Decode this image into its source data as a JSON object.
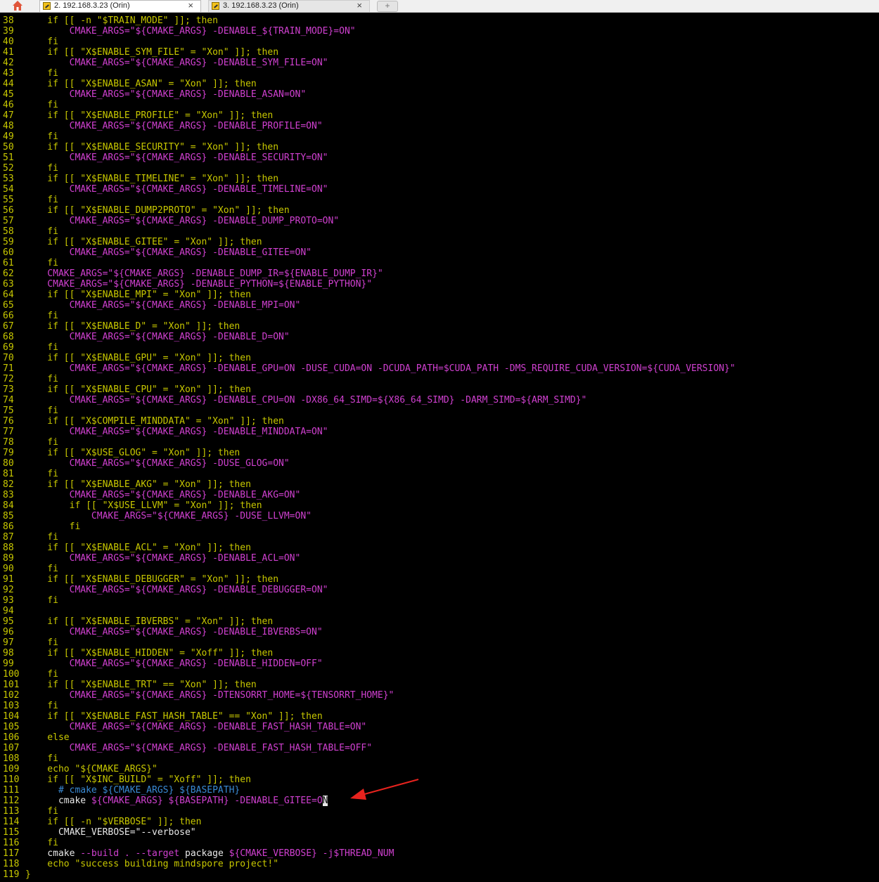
{
  "tabs": [
    {
      "label": "2. 192.168.3.23 (Orin)",
      "close": "×"
    },
    {
      "label": "3. 192.168.3.23 (Orin)",
      "close": "×"
    }
  ],
  "new_tab_label": "+",
  "code_lines": [
    {
      "n": "38",
      "segs": [
        [
          "g",
          "    if [[ -n \"$TRAIN_MODE\" ]]; then"
        ]
      ]
    },
    {
      "n": "39",
      "segs": [
        [
          "m",
          "        CMAKE_ARGS=\"${CMAKE_ARGS} -DENABLE_${TRAIN_MODE}=ON\""
        ]
      ]
    },
    {
      "n": "40",
      "segs": [
        [
          "g",
          "    fi"
        ]
      ]
    },
    {
      "n": "41",
      "segs": [
        [
          "g",
          "    if [[ \"X$ENABLE_SYM_FILE\" = \"Xon\" ]]; then"
        ]
      ]
    },
    {
      "n": "42",
      "segs": [
        [
          "m",
          "        CMAKE_ARGS=\"${CMAKE_ARGS} -DENABLE_SYM_FILE=ON\""
        ]
      ]
    },
    {
      "n": "43",
      "segs": [
        [
          "g",
          "    fi"
        ]
      ]
    },
    {
      "n": "44",
      "segs": [
        [
          "g",
          "    if [[ \"X$ENABLE_ASAN\" = \"Xon\" ]]; then"
        ]
      ]
    },
    {
      "n": "45",
      "segs": [
        [
          "m",
          "        CMAKE_ARGS=\"${CMAKE_ARGS} -DENABLE_ASAN=ON\""
        ]
      ]
    },
    {
      "n": "46",
      "segs": [
        [
          "g",
          "    fi"
        ]
      ]
    },
    {
      "n": "47",
      "segs": [
        [
          "g",
          "    if [[ \"X$ENABLE_PROFILE\" = \"Xon\" ]]; then"
        ]
      ]
    },
    {
      "n": "48",
      "segs": [
        [
          "m",
          "        CMAKE_ARGS=\"${CMAKE_ARGS} -DENABLE_PROFILE=ON\""
        ]
      ]
    },
    {
      "n": "49",
      "segs": [
        [
          "g",
          "    fi"
        ]
      ]
    },
    {
      "n": "50",
      "segs": [
        [
          "g",
          "    if [[ \"X$ENABLE_SECURITY\" = \"Xon\" ]]; then"
        ]
      ]
    },
    {
      "n": "51",
      "segs": [
        [
          "m",
          "        CMAKE_ARGS=\"${CMAKE_ARGS} -DENABLE_SECURITY=ON\""
        ]
      ]
    },
    {
      "n": "52",
      "segs": [
        [
          "g",
          "    fi"
        ]
      ]
    },
    {
      "n": "53",
      "segs": [
        [
          "g",
          "    if [[ \"X$ENABLE_TIMELINE\" = \"Xon\" ]]; then"
        ]
      ]
    },
    {
      "n": "54",
      "segs": [
        [
          "m",
          "        CMAKE_ARGS=\"${CMAKE_ARGS} -DENABLE_TIMELINE=ON\""
        ]
      ]
    },
    {
      "n": "55",
      "segs": [
        [
          "g",
          "    fi"
        ]
      ]
    },
    {
      "n": "56",
      "segs": [
        [
          "g",
          "    if [[ \"X$ENABLE_DUMP2PROTO\" = \"Xon\" ]]; then"
        ]
      ]
    },
    {
      "n": "57",
      "segs": [
        [
          "m",
          "        CMAKE_ARGS=\"${CMAKE_ARGS} -DENABLE_DUMP_PROTO=ON\""
        ]
      ]
    },
    {
      "n": "58",
      "segs": [
        [
          "g",
          "    fi"
        ]
      ]
    },
    {
      "n": "59",
      "segs": [
        [
          "g",
          "    if [[ \"X$ENABLE_GITEE\" = \"Xon\" ]]; then"
        ]
      ]
    },
    {
      "n": "60",
      "segs": [
        [
          "m",
          "        CMAKE_ARGS=\"${CMAKE_ARGS} -DENABLE_GITEE=ON\""
        ]
      ]
    },
    {
      "n": "61",
      "segs": [
        [
          "g",
          "    fi"
        ]
      ]
    },
    {
      "n": "62",
      "segs": [
        [
          "m",
          "    CMAKE_ARGS=\"${CMAKE_ARGS} -DENABLE_DUMP_IR=${ENABLE_DUMP_IR}\""
        ]
      ]
    },
    {
      "n": "63",
      "segs": [
        [
          "m",
          "    CMAKE_ARGS=\"${CMAKE_ARGS} -DENABLE_PYTHON=${ENABLE_PYTHON}\""
        ]
      ]
    },
    {
      "n": "64",
      "segs": [
        [
          "g",
          "    if [[ \"X$ENABLE_MPI\" = \"Xon\" ]]; then"
        ]
      ]
    },
    {
      "n": "65",
      "segs": [
        [
          "m",
          "        CMAKE_ARGS=\"${CMAKE_ARGS} -DENABLE_MPI=ON\""
        ]
      ]
    },
    {
      "n": "66",
      "segs": [
        [
          "g",
          "    fi"
        ]
      ]
    },
    {
      "n": "67",
      "segs": [
        [
          "g",
          "    if [[ \"X$ENABLE_D\" = \"Xon\" ]]; then"
        ]
      ]
    },
    {
      "n": "68",
      "segs": [
        [
          "m",
          "        CMAKE_ARGS=\"${CMAKE_ARGS} -DENABLE_D=ON\""
        ]
      ]
    },
    {
      "n": "69",
      "segs": [
        [
          "g",
          "    fi"
        ]
      ]
    },
    {
      "n": "70",
      "segs": [
        [
          "g",
          "    if [[ \"X$ENABLE_GPU\" = \"Xon\" ]]; then"
        ]
      ]
    },
    {
      "n": "71",
      "segs": [
        [
          "m",
          "        CMAKE_ARGS=\"${CMAKE_ARGS} -DENABLE_GPU=ON -DUSE_CUDA=ON -DCUDA_PATH=$CUDA_PATH -DMS_REQUIRE_CUDA_VERSION=${CUDA_VERSION}\""
        ]
      ]
    },
    {
      "n": "72",
      "segs": [
        [
          "g",
          "    fi"
        ]
      ]
    },
    {
      "n": "73",
      "segs": [
        [
          "g",
          "    if [[ \"X$ENABLE_CPU\" = \"Xon\" ]]; then"
        ]
      ]
    },
    {
      "n": "74",
      "segs": [
        [
          "m",
          "        CMAKE_ARGS=\"${CMAKE_ARGS} -DENABLE_CPU=ON -DX86_64_SIMD=${X86_64_SIMD} -DARM_SIMD=${ARM_SIMD}\""
        ]
      ]
    },
    {
      "n": "75",
      "segs": [
        [
          "g",
          "    fi"
        ]
      ]
    },
    {
      "n": "76",
      "segs": [
        [
          "g",
          "    if [[ \"X$COMPILE_MINDDATA\" = \"Xon\" ]]; then"
        ]
      ]
    },
    {
      "n": "77",
      "segs": [
        [
          "m",
          "        CMAKE_ARGS=\"${CMAKE_ARGS} -DENABLE_MINDDATA=ON\""
        ]
      ]
    },
    {
      "n": "78",
      "segs": [
        [
          "g",
          "    fi"
        ]
      ]
    },
    {
      "n": "79",
      "segs": [
        [
          "g",
          "    if [[ \"X$USE_GLOG\" = \"Xon\" ]]; then"
        ]
      ]
    },
    {
      "n": "80",
      "segs": [
        [
          "m",
          "        CMAKE_ARGS=\"${CMAKE_ARGS} -DUSE_GLOG=ON\""
        ]
      ]
    },
    {
      "n": "81",
      "segs": [
        [
          "g",
          "    fi"
        ]
      ]
    },
    {
      "n": "82",
      "segs": [
        [
          "g",
          "    if [[ \"X$ENABLE_AKG\" = \"Xon\" ]]; then"
        ]
      ]
    },
    {
      "n": "83",
      "segs": [
        [
          "m",
          "        CMAKE_ARGS=\"${CMAKE_ARGS} -DENABLE_AKG=ON\""
        ]
      ]
    },
    {
      "n": "84",
      "segs": [
        [
          "g",
          "        if [[ \"X$USE_LLVM\" = \"Xon\" ]]; then"
        ]
      ]
    },
    {
      "n": "85",
      "segs": [
        [
          "m",
          "            CMAKE_ARGS=\"${CMAKE_ARGS} -DUSE_LLVM=ON\""
        ]
      ]
    },
    {
      "n": "86",
      "segs": [
        [
          "g",
          "        fi"
        ]
      ]
    },
    {
      "n": "87",
      "segs": [
        [
          "g",
          "    fi"
        ]
      ]
    },
    {
      "n": "88",
      "segs": [
        [
          "g",
          "    if [[ \"X$ENABLE_ACL\" = \"Xon\" ]]; then"
        ]
      ]
    },
    {
      "n": "89",
      "segs": [
        [
          "m",
          "        CMAKE_ARGS=\"${CMAKE_ARGS} -DENABLE_ACL=ON\""
        ]
      ]
    },
    {
      "n": "90",
      "segs": [
        [
          "g",
          "    fi"
        ]
      ]
    },
    {
      "n": "91",
      "segs": [
        [
          "g",
          "    if [[ \"X$ENABLE_DEBUGGER\" = \"Xon\" ]]; then"
        ]
      ]
    },
    {
      "n": "92",
      "segs": [
        [
          "m",
          "        CMAKE_ARGS=\"${CMAKE_ARGS} -DENABLE_DEBUGGER=ON\""
        ]
      ]
    },
    {
      "n": "93",
      "segs": [
        [
          "g",
          "    fi"
        ]
      ]
    },
    {
      "n": "94",
      "segs": [
        [
          "g",
          ""
        ]
      ]
    },
    {
      "n": "95",
      "segs": [
        [
          "g",
          "    if [[ \"X$ENABLE_IBVERBS\" = \"Xon\" ]]; then"
        ]
      ]
    },
    {
      "n": "96",
      "segs": [
        [
          "m",
          "        CMAKE_ARGS=\"${CMAKE_ARGS} -DENABLE_IBVERBS=ON\""
        ]
      ]
    },
    {
      "n": "97",
      "segs": [
        [
          "g",
          "    fi"
        ]
      ]
    },
    {
      "n": "98",
      "segs": [
        [
          "g",
          "    if [[ \"X$ENABLE_HIDDEN\" = \"Xoff\" ]]; then"
        ]
      ]
    },
    {
      "n": "99",
      "segs": [
        [
          "m",
          "        CMAKE_ARGS=\"${CMAKE_ARGS} -DENABLE_HIDDEN=OFF\""
        ]
      ]
    },
    {
      "n": "100",
      "segs": [
        [
          "g",
          "    fi"
        ]
      ]
    },
    {
      "n": "101",
      "segs": [
        [
          "g",
          "    if [[ \"X$ENABLE_TRT\" == \"Xon\" ]]; then"
        ]
      ]
    },
    {
      "n": "102",
      "segs": [
        [
          "m",
          "        CMAKE_ARGS=\"${CMAKE_ARGS} -DTENSORRT_HOME=${TENSORRT_HOME}\""
        ]
      ]
    },
    {
      "n": "103",
      "segs": [
        [
          "g",
          "    fi"
        ]
      ]
    },
    {
      "n": "104",
      "segs": [
        [
          "g",
          "    if [[ \"X$ENABLE_FAST_HASH_TABLE\" == \"Xon\" ]]; then"
        ]
      ]
    },
    {
      "n": "105",
      "segs": [
        [
          "m",
          "        CMAKE_ARGS=\"${CMAKE_ARGS} -DENABLE_FAST_HASH_TABLE=ON\""
        ]
      ]
    },
    {
      "n": "106",
      "segs": [
        [
          "g",
          "    else"
        ]
      ]
    },
    {
      "n": "107",
      "segs": [
        [
          "m",
          "        CMAKE_ARGS=\"${CMAKE_ARGS} -DENABLE_FAST_HASH_TABLE=OFF\""
        ]
      ]
    },
    {
      "n": "108",
      "segs": [
        [
          "g",
          "    fi"
        ]
      ]
    },
    {
      "n": "109",
      "segs": [
        [
          "g",
          "    echo \"${CMAKE_ARGS}\""
        ]
      ]
    },
    {
      "n": "110",
      "segs": [
        [
          "g",
          "    if [[ \"X$INC_BUILD\" = \"Xoff\" ]]; then"
        ]
      ]
    },
    {
      "n": "111",
      "segs": [
        [
          "c",
          "      # cmake ${CMAKE_ARGS} ${BASEPATH}"
        ]
      ]
    },
    {
      "n": "112",
      "segs": [
        [
          "w",
          "      cmake "
        ],
        [
          "m",
          "${CMAKE_ARGS} ${BASEPATH} -DENABLE_GITEE=O"
        ],
        [
          "cur",
          "N"
        ]
      ]
    },
    {
      "n": "113",
      "segs": [
        [
          "g",
          "    fi"
        ]
      ]
    },
    {
      "n": "114",
      "segs": [
        [
          "g",
          "    if [[ -n \"$VERBOSE\" ]]; then"
        ]
      ]
    },
    {
      "n": "115",
      "segs": [
        [
          "w",
          "      CMAKE_VERBOSE=\"--verbose\""
        ]
      ]
    },
    {
      "n": "116",
      "segs": [
        [
          "g",
          "    fi"
        ]
      ]
    },
    {
      "n": "117",
      "segs": [
        [
          "w",
          "    cmake "
        ],
        [
          "m",
          "--build . --target "
        ],
        [
          "w",
          "package "
        ],
        [
          "m",
          "${CMAKE_VERBOSE} -j$THREAD_NUM"
        ]
      ]
    },
    {
      "n": "118",
      "segs": [
        [
          "g",
          "    echo \"success building mindspore project!\""
        ]
      ]
    },
    {
      "n": "119",
      "segs": [
        [
          "g",
          "}"
        ]
      ]
    }
  ],
  "colors": {
    "keyword": "#c8c800",
    "string": "#d040d0",
    "comment": "#3a8ad4",
    "annotation_arrow": "#e8231e"
  }
}
